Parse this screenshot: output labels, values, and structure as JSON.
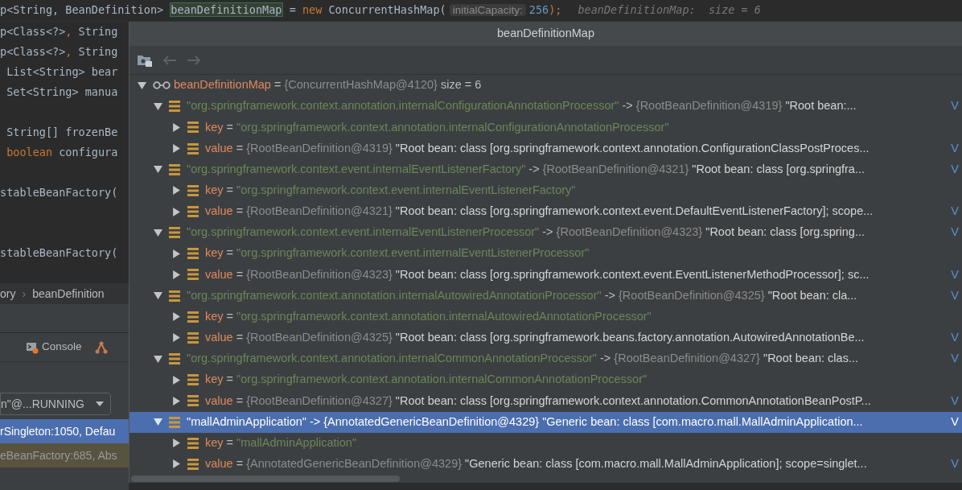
{
  "editor": {
    "top_line": [
      {
        "text": "p<String, BeanDefinition> ",
        "kind": "plain"
      },
      {
        "text": "beanDefinitionMap",
        "kind": "highlighted"
      },
      {
        "text": " = ",
        "kind": "plain"
      },
      {
        "text": "new",
        "kind": "keyword"
      },
      {
        "text": " ConcurrentHashMap(",
        "kind": "plain"
      },
      {
        "text": "initialCapacity:",
        "kind": "hint"
      },
      {
        "text": "256",
        "kind": "number"
      },
      {
        "text": ");",
        "kind": "punct"
      },
      {
        "text": "beanDefinitionMap:  size = 6",
        "kind": "inline_value"
      }
    ],
    "lines": [
      [
        {
          "text": "p<Class<?>",
          "kind": "plain"
        },
        {
          "text": ",",
          "kind": "punct"
        },
        {
          "text": " String",
          "kind": "plain"
        }
      ],
      [
        {
          "text": "p<Class<?>",
          "kind": "plain"
        },
        {
          "text": ",",
          "kind": "punct"
        },
        {
          "text": " String",
          "kind": "plain"
        }
      ],
      [
        {
          "text": " List<String> bear",
          "kind": "plain"
        }
      ],
      [
        {
          "text": " Set<String> manua",
          "kind": "plain"
        }
      ],
      [
        {
          "text": " String[] frozenBe",
          "kind": "plain"
        }
      ],
      [
        {
          "text": " boolean",
          "kind": "keyword"
        },
        {
          "text": " configura",
          "kind": "plain"
        }
      ],
      [
        {
          "text": "stableBeanFactory(",
          "kind": "plain"
        }
      ],
      [
        {
          "text": "stableBeanFactory(",
          "kind": "plain"
        }
      ]
    ]
  },
  "breadcrumb": {
    "items": [
      "ory",
      "beanDefinition"
    ],
    "separator": "›"
  },
  "debug_tabs": [
    {
      "label": "Console",
      "selected": false
    }
  ],
  "thread_selector": {
    "value": "n\"@...RUNNING"
  },
  "frames": [
    {
      "label": "rSingleton:1050, Defau",
      "selected": true,
      "kind": "app"
    },
    {
      "label": "eBeanFactory:685, Abs",
      "selected": false,
      "kind": "library"
    }
  ],
  "popup": {
    "title": "beanDefinitionMap",
    "tree": {
      "name": "beanDefinitionMap",
      "separator": "=",
      "ref": "{ConcurrentHashMap@4120}",
      "summary": "size = 6",
      "expanded": true,
      "children": [
        {
          "kind": "entry",
          "key": "\"org.springframework.context.annotation.internalConfigurationAnnotationProcessor\"",
          "arrow": "->",
          "ref": "{RootBeanDefinition@4319}",
          "summary": "\"Root bean:...",
          "link": "V",
          "expanded": true,
          "selected": false,
          "children": [
            {
              "kind": "field",
              "name": "key",
              "separator": "=",
              "value": "\"org.springframework.context.annotation.internalConfigurationAnnotationProcessor\"",
              "expanded": false
            },
            {
              "kind": "field",
              "name": "value",
              "separator": "=",
              "ref": "{RootBeanDefinition@4319}",
              "summary": "\"Root bean: class [org.springframework.context.annotation.ConfigurationClassPostProces...",
              "link": "V",
              "expanded": false
            }
          ]
        },
        {
          "kind": "entry",
          "key": "\"org.springframework.context.event.internalEventListenerFactory\"",
          "arrow": "->",
          "ref": "{RootBeanDefinition@4321}",
          "summary": "\"Root bean: class [org.springfra...",
          "link": "V",
          "expanded": true,
          "selected": false,
          "children": [
            {
              "kind": "field",
              "name": "key",
              "separator": "=",
              "value": "\"org.springframework.context.event.internalEventListenerFactory\"",
              "expanded": false
            },
            {
              "kind": "field",
              "name": "value",
              "separator": "=",
              "ref": "{RootBeanDefinition@4321}",
              "summary": "\"Root bean: class [org.springframework.context.event.DefaultEventListenerFactory]; scope...",
              "link": "V",
              "expanded": false
            }
          ]
        },
        {
          "kind": "entry",
          "key": "\"org.springframework.context.event.internalEventListenerProcessor\"",
          "arrow": "->",
          "ref": "{RootBeanDefinition@4323}",
          "summary": "\"Root bean: class [org.spring...",
          "link": "V",
          "expanded": true,
          "selected": false,
          "children": [
            {
              "kind": "field",
              "name": "key",
              "separator": "=",
              "value": "\"org.springframework.context.event.internalEventListenerProcessor\"",
              "expanded": false
            },
            {
              "kind": "field",
              "name": "value",
              "separator": "=",
              "ref": "{RootBeanDefinition@4323}",
              "summary": "\"Root bean: class [org.springframework.context.event.EventListenerMethodProcessor]; sc...",
              "link": "V",
              "expanded": false
            }
          ]
        },
        {
          "kind": "entry",
          "key": "\"org.springframework.context.annotation.internalAutowiredAnnotationProcessor\"",
          "arrow": "->",
          "ref": "{RootBeanDefinition@4325}",
          "summary": "\"Root bean: cla...",
          "link": "V",
          "expanded": true,
          "selected": false,
          "children": [
            {
              "kind": "field",
              "name": "key",
              "separator": "=",
              "value": "\"org.springframework.context.annotation.internalAutowiredAnnotationProcessor\"",
              "expanded": false
            },
            {
              "kind": "field",
              "name": "value",
              "separator": "=",
              "ref": "{RootBeanDefinition@4325}",
              "summary": "\"Root bean: class [org.springframework.beans.factory.annotation.AutowiredAnnotationBe...",
              "link": "V",
              "expanded": false
            }
          ]
        },
        {
          "kind": "entry",
          "key": "\"org.springframework.context.annotation.internalCommonAnnotationProcessor\"",
          "arrow": "->",
          "ref": "{RootBeanDefinition@4327}",
          "summary": "\"Root bean: clas...",
          "link": "V",
          "expanded": true,
          "selected": false,
          "children": [
            {
              "kind": "field",
              "name": "key",
              "separator": "=",
              "value": "\"org.springframework.context.annotation.internalCommonAnnotationProcessor\"",
              "expanded": false
            },
            {
              "kind": "field",
              "name": "value",
              "separator": "=",
              "ref": "{RootBeanDefinition@4327}",
              "summary": "\"Root bean: class [org.springframework.context.annotation.CommonAnnotationBeanPostP...",
              "link": "V",
              "expanded": false
            }
          ]
        },
        {
          "kind": "entry",
          "key": "\"mallAdminApplication\"",
          "arrow": "->",
          "ref": "{AnnotatedGenericBeanDefinition@4329}",
          "summary": "\"Generic bean: class [com.macro.mall.MallAdminApplication...",
          "link": "V",
          "expanded": true,
          "selected": true,
          "children": [
            {
              "kind": "field",
              "name": "key",
              "separator": "=",
              "value": "\"mallAdminApplication\"",
              "expanded": false
            },
            {
              "kind": "field",
              "name": "value",
              "separator": "=",
              "ref": "{AnnotatedGenericBeanDefinition@4329}",
              "summary": "\"Generic bean: class [com.macro.mall.MallAdminApplication]; scope=singlet...",
              "link": "V",
              "expanded": false
            }
          ]
        }
      ]
    }
  }
}
